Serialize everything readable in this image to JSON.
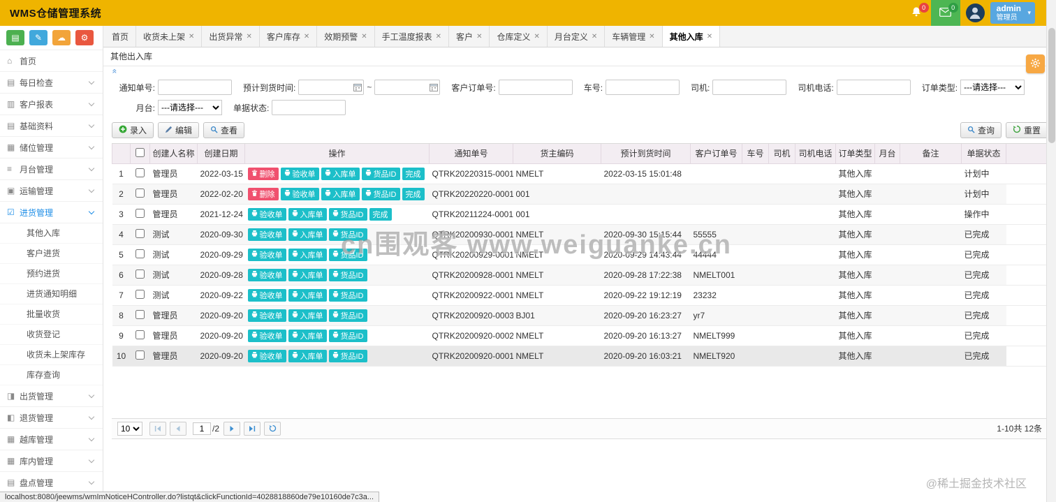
{
  "colors": {
    "header_bg": "#efb400",
    "accent_teal": "#1cbfc9",
    "danger_red": "#f0506e",
    "active_blue": "#1f8ee7",
    "green": "#4cb050"
  },
  "header": {
    "title": "WMS仓储管理系统",
    "bell_badge": "0",
    "mail_badge": "0",
    "user_name": "admin",
    "user_role": "管理员"
  },
  "sidebar": {
    "quick_buttons": [
      {
        "name": "chart-button",
        "icon": "chart-icon",
        "glyph": "▤",
        "color": "#4cb050"
      },
      {
        "name": "pencil-button",
        "icon": "pencil-icon",
        "glyph": "✎",
        "color": "#41a8dc"
      },
      {
        "name": "bird-button",
        "icon": "bird-icon",
        "glyph": "☁",
        "color": "#f2a43a"
      },
      {
        "name": "gear-button",
        "icon": "gears-icon",
        "glyph": "⚙",
        "color": "#e9573f"
      }
    ],
    "items": [
      {
        "label": "首页",
        "icon": "home-icon",
        "glyph": "⌂",
        "expandable": false
      },
      {
        "label": "每日检查",
        "icon": "daily-check-icon",
        "glyph": "▤",
        "expandable": true
      },
      {
        "label": "客户报表",
        "icon": "customer-report-icon",
        "glyph": "▥",
        "expandable": true
      },
      {
        "label": "基础资料",
        "icon": "base-data-icon",
        "glyph": "▤",
        "expandable": true
      },
      {
        "label": "储位管理",
        "icon": "storage-icon",
        "glyph": "▦",
        "expandable": true
      },
      {
        "label": "月台管理",
        "icon": "dock-icon",
        "glyph": "≡",
        "expandable": true
      },
      {
        "label": "运输管理",
        "icon": "transport-icon",
        "glyph": "▣",
        "expandable": true
      },
      {
        "label": "进货管理",
        "icon": "inbound-icon",
        "glyph": "☑",
        "expandable": true,
        "active": true,
        "children": [
          "其他入库",
          "客户进货",
          "预约进货",
          "进货通知明细",
          "批量收货",
          "收货登记",
          "收货未上架库存",
          "库存查询"
        ]
      },
      {
        "label": "出货管理",
        "icon": "outbound-icon",
        "glyph": "◨",
        "expandable": true
      },
      {
        "label": "退货管理",
        "icon": "return-icon",
        "glyph": "◧",
        "expandable": true
      },
      {
        "label": "越库管理",
        "icon": "cross-dock-icon",
        "glyph": "▦",
        "expandable": true
      },
      {
        "label": "库内管理",
        "icon": "in-warehouse-icon",
        "glyph": "▦",
        "expandable": true
      },
      {
        "label": "盘点管理",
        "icon": "stocktake-icon",
        "glyph": "▤",
        "expandable": true
      }
    ]
  },
  "tabs": [
    {
      "label": "首页",
      "closable": false
    },
    {
      "label": "收货未上架",
      "closable": true
    },
    {
      "label": "出货异常",
      "closable": true
    },
    {
      "label": "客户库存",
      "closable": true
    },
    {
      "label": "效期预警",
      "closable": true
    },
    {
      "label": "手工温度报表",
      "closable": true
    },
    {
      "label": "客户",
      "closable": true
    },
    {
      "label": "仓库定义",
      "closable": true
    },
    {
      "label": "月台定义",
      "closable": true
    },
    {
      "label": "车辆管理",
      "closable": true
    },
    {
      "label": "其他入库",
      "closable": true,
      "active": true
    }
  ],
  "panel": {
    "title": "其他出入库"
  },
  "filters": {
    "row1": [
      {
        "label": "通知单号:",
        "type": "text"
      },
      {
        "label": "预计到货时间:",
        "type": "daterange",
        "separator": "~"
      },
      {
        "label": "客户订单号:",
        "type": "text"
      },
      {
        "label": "车号:",
        "type": "text"
      },
      {
        "label": "司机:",
        "type": "text"
      },
      {
        "label": "司机电话:",
        "type": "text"
      },
      {
        "label": "订单类型:",
        "type": "select",
        "value": "---请选择---"
      }
    ],
    "row2": [
      {
        "label": "月台:",
        "type": "select",
        "value": "---请选择---"
      },
      {
        "label": "单据状态:",
        "type": "text"
      }
    ]
  },
  "toolbar": {
    "add": "录入",
    "edit": "编辑",
    "view": "查看",
    "search": "查询",
    "reset": "重置"
  },
  "table": {
    "columns": [
      {
        "key": "num",
        "label": ""
      },
      {
        "key": "check",
        "label": "",
        "type": "checkbox"
      },
      {
        "key": "creator",
        "label": "创建人名称"
      },
      {
        "key": "date",
        "label": "创建日期"
      },
      {
        "key": "actions",
        "label": "操作"
      },
      {
        "key": "notice_no",
        "label": "通知单号"
      },
      {
        "key": "owner_code",
        "label": "货主编码"
      },
      {
        "key": "eta",
        "label": "预计到货时间"
      },
      {
        "key": "customer_order_no",
        "label": "客户订单号"
      },
      {
        "key": "vehicle_no",
        "label": "车号"
      },
      {
        "key": "driver",
        "label": "司机"
      },
      {
        "key": "driver_phone",
        "label": "司机电话"
      },
      {
        "key": "order_type",
        "label": "订单类型"
      },
      {
        "key": "dock",
        "label": "月台"
      },
      {
        "key": "remark",
        "label": "备注"
      },
      {
        "key": "status",
        "label": "单据状态"
      },
      {
        "key": "filler",
        "label": ""
      }
    ],
    "rows": [
      {
        "num": "1",
        "creator": "管理员",
        "date": "2022-03-15",
        "actions": [
          {
            "name": "delete-button",
            "label": "删除",
            "icon": "trash-icon",
            "style": "danger"
          },
          {
            "name": "receipt-doc-button",
            "label": "验收单",
            "icon": "print-icon",
            "style": "teal"
          },
          {
            "name": "inbound-doc-button",
            "label": "入库单",
            "icon": "print-icon",
            "style": "teal"
          },
          {
            "name": "item-id-button",
            "label": "货品ID",
            "icon": "print-icon",
            "style": "teal"
          },
          {
            "name": "complete-button",
            "label": "完成",
            "icon": "",
            "style": "teal"
          }
        ],
        "notice_no": "QTRK20220315-0001",
        "owner_code": "NMELT",
        "eta": "2022-03-15 15:01:48",
        "customer_order_no": "",
        "vehicle_no": "",
        "driver": "",
        "driver_phone": "",
        "order_type": "其他入库",
        "dock": "",
        "remark": "",
        "status": "计划中"
      },
      {
        "num": "2",
        "creator": "管理员",
        "date": "2022-02-20",
        "actions": [
          {
            "name": "delete-button",
            "label": "删除",
            "icon": "trash-icon",
            "style": "danger"
          },
          {
            "name": "receipt-doc-button",
            "label": "验收单",
            "icon": "print-icon",
            "style": "teal"
          },
          {
            "name": "inbound-doc-button",
            "label": "入库单",
            "icon": "print-icon",
            "style": "teal"
          },
          {
            "name": "item-id-button",
            "label": "货品ID",
            "icon": "print-icon",
            "style": "teal"
          },
          {
            "name": "complete-button",
            "label": "完成",
            "icon": "",
            "style": "teal"
          }
        ],
        "notice_no": "QTRK20220220-0001",
        "owner_code": "001",
        "eta": "",
        "customer_order_no": "",
        "vehicle_no": "",
        "driver": "",
        "driver_phone": "",
        "order_type": "其他入库",
        "dock": "",
        "remark": "",
        "status": "计划中"
      },
      {
        "num": "3",
        "creator": "管理员",
        "date": "2021-12-24",
        "actions": [
          {
            "name": "receipt-doc-button",
            "label": "验收单",
            "icon": "print-icon",
            "style": "teal"
          },
          {
            "name": "inbound-doc-button",
            "label": "入库单",
            "icon": "print-icon",
            "style": "teal"
          },
          {
            "name": "item-id-button",
            "label": "货品ID",
            "icon": "print-icon",
            "style": "teal"
          },
          {
            "name": "complete-button",
            "label": "完成",
            "icon": "",
            "style": "teal"
          }
        ],
        "notice_no": "QTRK20211224-0001",
        "owner_code": "001",
        "eta": "",
        "customer_order_no": "",
        "vehicle_no": "",
        "driver": "",
        "driver_phone": "",
        "order_type": "其他入库",
        "dock": "",
        "remark": "",
        "status": "操作中"
      },
      {
        "num": "4",
        "creator": "测试",
        "date": "2020-09-30",
        "actions": [
          {
            "name": "receipt-doc-button",
            "label": "验收单",
            "icon": "print-icon",
            "style": "teal"
          },
          {
            "name": "inbound-doc-button",
            "label": "入库单",
            "icon": "print-icon",
            "style": "teal"
          },
          {
            "name": "item-id-button",
            "label": "货品ID",
            "icon": "print-icon",
            "style": "teal"
          }
        ],
        "notice_no": "QTRK20200930-0001",
        "owner_code": "NMELT",
        "eta": "2020-09-30 15:15:44",
        "customer_order_no": "55555",
        "vehicle_no": "",
        "driver": "",
        "driver_phone": "",
        "order_type": "其他入库",
        "dock": "",
        "remark": "",
        "status": "已完成"
      },
      {
        "num": "5",
        "creator": "测试",
        "date": "2020-09-29",
        "actions": [
          {
            "name": "receipt-doc-button",
            "label": "验收单",
            "icon": "print-icon",
            "style": "teal"
          },
          {
            "name": "inbound-doc-button",
            "label": "入库单",
            "icon": "print-icon",
            "style": "teal"
          },
          {
            "name": "item-id-button",
            "label": "货品ID",
            "icon": "print-icon",
            "style": "teal"
          }
        ],
        "notice_no": "QTRK20200929-0001",
        "owner_code": "NMELT",
        "eta": "2020-09-29 14:43:44",
        "customer_order_no": "44444",
        "vehicle_no": "",
        "driver": "",
        "driver_phone": "",
        "order_type": "其他入库",
        "dock": "",
        "remark": "",
        "status": "已完成"
      },
      {
        "num": "6",
        "creator": "测试",
        "date": "2020-09-28",
        "actions": [
          {
            "name": "receipt-doc-button",
            "label": "验收单",
            "icon": "print-icon",
            "style": "teal"
          },
          {
            "name": "inbound-doc-button",
            "label": "入库单",
            "icon": "print-icon",
            "style": "teal"
          },
          {
            "name": "item-id-button",
            "label": "货品ID",
            "icon": "print-icon",
            "style": "teal"
          }
        ],
        "notice_no": "QTRK20200928-0001",
        "owner_code": "NMELT",
        "eta": "2020-09-28 17:22:38",
        "customer_order_no": "NMELT001",
        "vehicle_no": "",
        "driver": "",
        "driver_phone": "",
        "order_type": "其他入库",
        "dock": "",
        "remark": "",
        "status": "已完成"
      },
      {
        "num": "7",
        "creator": "测试",
        "date": "2020-09-22",
        "actions": [
          {
            "name": "receipt-doc-button",
            "label": "验收单",
            "icon": "print-icon",
            "style": "teal"
          },
          {
            "name": "inbound-doc-button",
            "label": "入库单",
            "icon": "print-icon",
            "style": "teal"
          },
          {
            "name": "item-id-button",
            "label": "货品ID",
            "icon": "print-icon",
            "style": "teal"
          }
        ],
        "notice_no": "QTRK20200922-0001",
        "owner_code": "NMELT",
        "eta": "2020-09-22 19:12:19",
        "customer_order_no": "23232",
        "vehicle_no": "",
        "driver": "",
        "driver_phone": "",
        "order_type": "其他入库",
        "dock": "",
        "remark": "",
        "status": "已完成"
      },
      {
        "num": "8",
        "creator": "管理员",
        "date": "2020-09-20",
        "actions": [
          {
            "name": "receipt-doc-button",
            "label": "验收单",
            "icon": "print-icon",
            "style": "teal"
          },
          {
            "name": "inbound-doc-button",
            "label": "入库单",
            "icon": "print-icon",
            "style": "teal"
          },
          {
            "name": "item-id-button",
            "label": "货品ID",
            "icon": "print-icon",
            "style": "teal"
          }
        ],
        "notice_no": "QTRK20200920-0003",
        "owner_code": "BJ01",
        "eta": "2020-09-20 16:23:27",
        "customer_order_no": "yr7",
        "vehicle_no": "",
        "driver": "",
        "driver_phone": "",
        "order_type": "其他入库",
        "dock": "",
        "remark": "",
        "status": "已完成"
      },
      {
        "num": "9",
        "creator": "管理员",
        "date": "2020-09-20",
        "actions": [
          {
            "name": "receipt-doc-button",
            "label": "验收单",
            "icon": "print-icon",
            "style": "teal"
          },
          {
            "name": "inbound-doc-button",
            "label": "入库单",
            "icon": "print-icon",
            "style": "teal"
          },
          {
            "name": "item-id-button",
            "label": "货品ID",
            "icon": "print-icon",
            "style": "teal"
          }
        ],
        "notice_no": "QTRK20200920-0002",
        "owner_code": "NMELT",
        "eta": "2020-09-20 16:13:27",
        "customer_order_no": "NMELT999",
        "vehicle_no": "",
        "driver": "",
        "driver_phone": "",
        "order_type": "其他入库",
        "dock": "",
        "remark": "",
        "status": "已完成"
      },
      {
        "num": "10",
        "creator": "管理员",
        "date": "2020-09-20",
        "highlight": true,
        "actions": [
          {
            "name": "receipt-doc-button",
            "label": "验收单",
            "icon": "print-icon",
            "style": "teal"
          },
          {
            "name": "inbound-doc-button",
            "label": "入库单",
            "icon": "print-icon",
            "style": "teal"
          },
          {
            "name": "item-id-button",
            "label": "货品ID",
            "icon": "print-icon",
            "style": "teal"
          }
        ],
        "notice_no": "QTRK20200920-0001",
        "owner_code": "NMELT",
        "eta": "2020-09-20 16:03:21",
        "customer_order_no": "NMELT920",
        "vehicle_no": "",
        "driver": "",
        "driver_phone": "",
        "order_type": "其他入库",
        "dock": "",
        "remark": "",
        "status": "已完成"
      }
    ]
  },
  "pagination": {
    "page_size": "10",
    "current_page": "1",
    "total_pages_label": "/2",
    "info": "1-10共 12条"
  },
  "watermark": {
    "center": "cn围观客 www.weiguanke.cn",
    "footer": "@稀土掘金技术社区"
  },
  "statusbar": {
    "text": "localhost:8080/jeewms/wmImNoticeHController.do?listqt&clickFunctionId=4028818860de79e10160de7c3a..."
  }
}
